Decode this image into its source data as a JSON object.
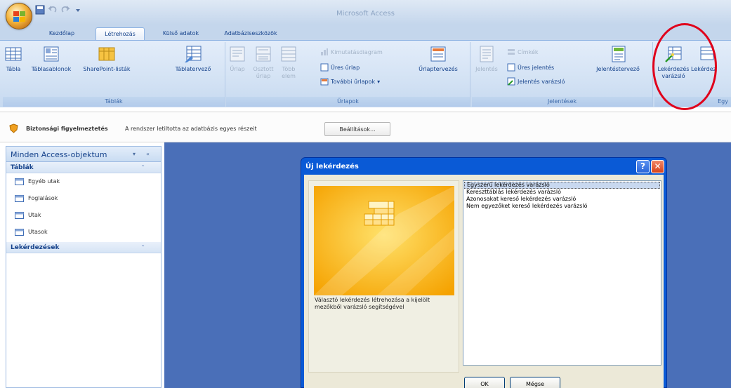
{
  "window": {
    "title": "Microsoft Access"
  },
  "tabs": [
    "Kezdőlap",
    "Létrehozás",
    "Külső adatok",
    "Adatbáziseszközök"
  ],
  "ribbon": {
    "tablak": {
      "label": "Táblák",
      "buttons": [
        "Tábla",
        "Táblasablonok",
        "SharePoint-listák",
        "Táblatervező"
      ]
    },
    "urlapok": {
      "label": "Űrlapok",
      "buttons": [
        "Űrlap",
        "Osztott űrlap",
        "Több elem",
        "Űrlaptervezés"
      ],
      "small": [
        "Kimutatásdiagram",
        "Üres űrlap",
        "További űrlapok"
      ]
    },
    "jelentesek": {
      "label": "Jelentések",
      "buttons": [
        "Jelentés",
        "Jelentéstervező"
      ],
      "small": [
        "Címkék",
        "Üres jelentés",
        "Jelentés varázsló"
      ]
    },
    "egyeb": {
      "label": "Egy",
      "buttons": [
        "Lekérdezés varázsló",
        "Lekérdez"
      ]
    }
  },
  "security": {
    "title": "Biztonsági figyelmeztetés",
    "message": "A rendszer letiltotta az adatbázis egyes részeit",
    "button": "Beállítások..."
  },
  "nav": {
    "header": "Minden Access-objektum",
    "groups": [
      {
        "label": "Táblák",
        "items": [
          "Egyéb utak",
          "Foglalások",
          "Utak",
          "Utasok"
        ]
      },
      {
        "label": "Lekérdezések",
        "items": []
      }
    ]
  },
  "dialog": {
    "title": "Új lekérdezés",
    "description": "Választó lekérdezés létrehozása a kijelölt mezőkből varázsló segítségével",
    "options": [
      "Egyszerű lekérdezés varázsló",
      "Kereszttáblás lekérdezés varázsló",
      "Azonosakat kereső lekérdezés varázsló",
      "Nem egyezőket kereső lekérdezés varázsló"
    ],
    "selected_index": 0,
    "ok": "OK",
    "cancel": "Mégse"
  }
}
